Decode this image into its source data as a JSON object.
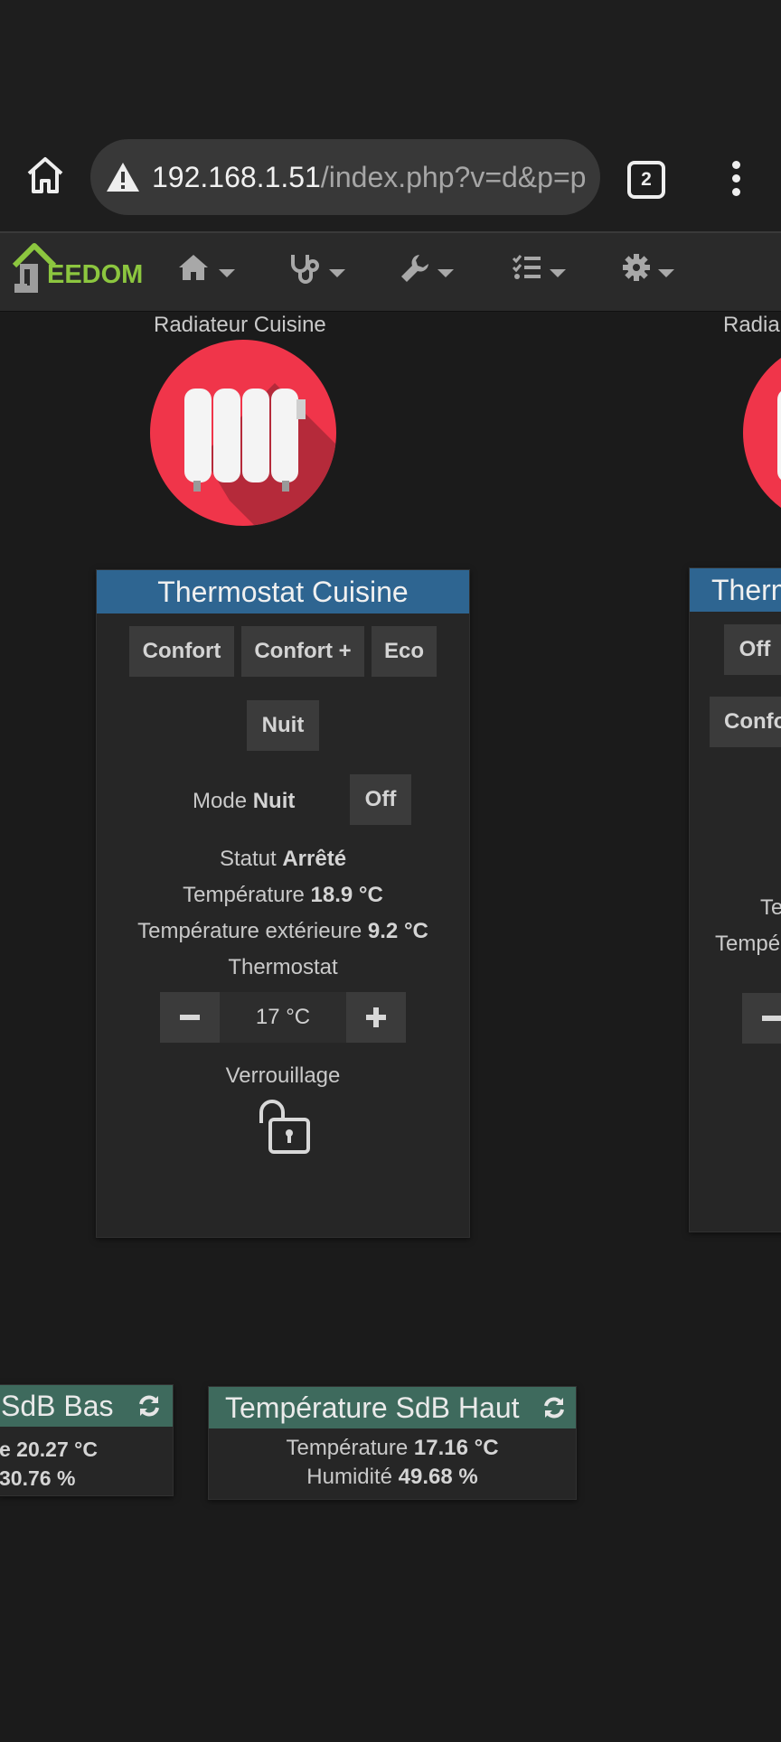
{
  "browser": {
    "url_host": "192.168.1.51",
    "url_path": "/index.php?v=d&p=p",
    "tab_count": "2"
  },
  "nav": {
    "logo": "EEDOM",
    "items": [
      "home-icon",
      "stethoscope-icon",
      "wrench-icon",
      "list-check-icon",
      "gear-icon"
    ]
  },
  "equipment": {
    "radiator_label": "Radiateur Cuisine",
    "radiator_label_partial": "Radia"
  },
  "thermostat": {
    "title": "Thermostat Cuisine",
    "buttons": [
      "Confort",
      "Confort +",
      "Eco",
      "Nuit"
    ],
    "mode_label": "Mode",
    "mode_value": "Nuit",
    "off_label": "Off",
    "statut_label": "Statut",
    "statut_value": "Arrêté",
    "temp_label": "Température",
    "temp_value": "18.9 °C",
    "ext_label": "Température extérieure",
    "ext_value": "9.2 °C",
    "thermostat_label": "Thermostat",
    "setpoint": "17 °C",
    "lock_label": "Verrouillage"
  },
  "thermostat_partial": {
    "title": "Therm",
    "off_label": "Off",
    "confort_label": "Confo",
    "te_label": "Te",
    "tempe_label": "Tempé"
  },
  "sdb_bas": {
    "title": "SdB Bas",
    "temp_value": "e 20.27 °C",
    "hum_value": "30.76 %"
  },
  "sdb_haut": {
    "title": "Température SdB Haut",
    "temp_label": "Température",
    "temp_value": "17.16 °C",
    "hum_label": "Humidité",
    "hum_value": "49.68 %"
  },
  "colors": {
    "widget_header": "#2e6591",
    "tile_header": "#3e6a5d",
    "radiator_circle": "#f0354a",
    "logo_green": "#8cc63f"
  }
}
